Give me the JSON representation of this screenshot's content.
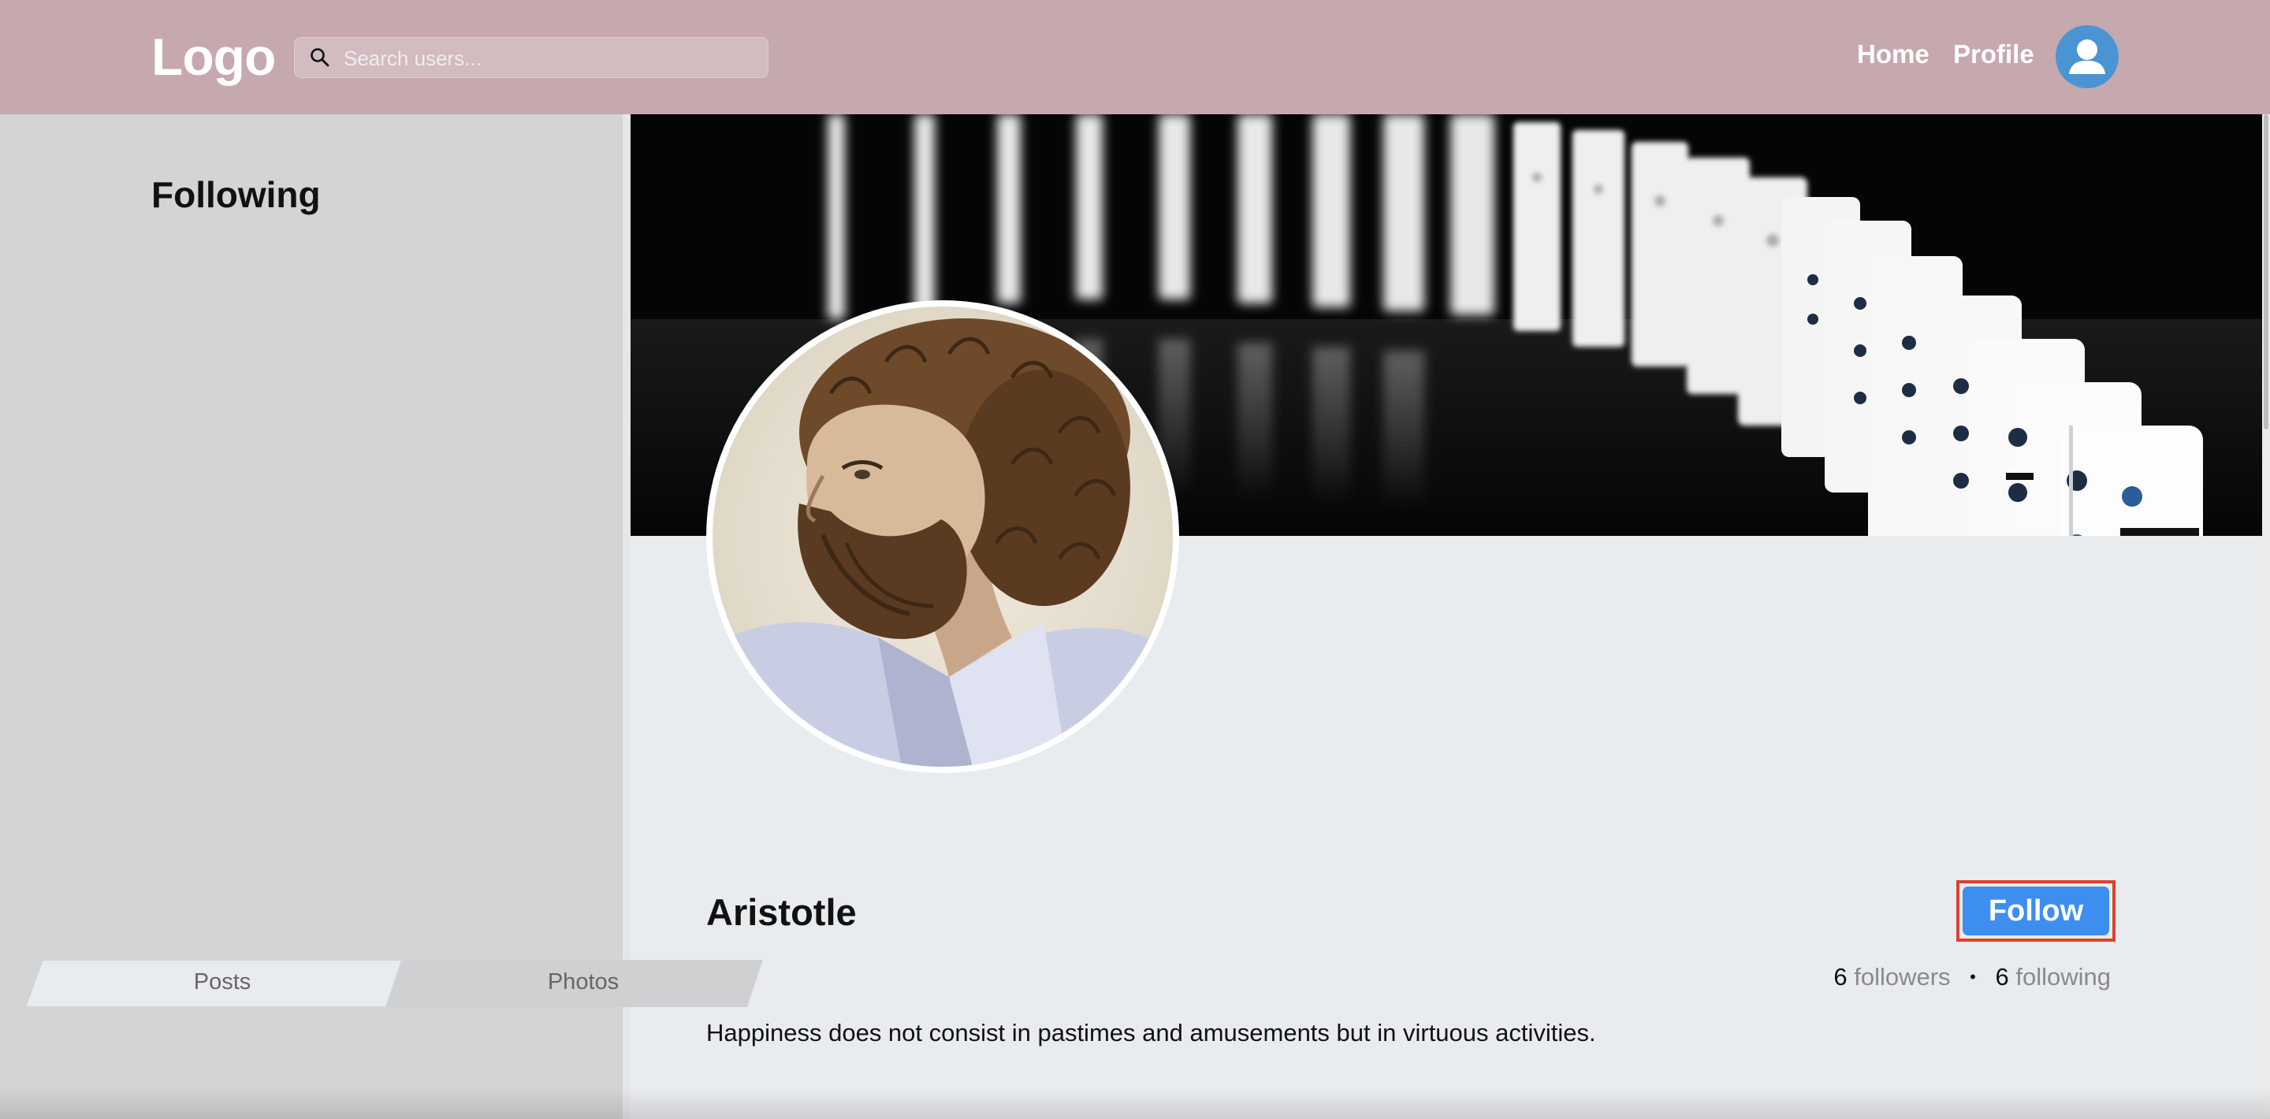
{
  "header": {
    "logo": "Logo",
    "search_placeholder": "Search users...",
    "search_value": "",
    "nav": {
      "home": "Home",
      "profile": "Profile"
    },
    "avatar_icon": "user-avatar-icon",
    "background_color": "#c6a9ae"
  },
  "sidebar": {
    "title": "Following",
    "items": []
  },
  "profile": {
    "cover_image": "dominoes-cover-image",
    "photo": "aristotle-portrait",
    "name": "Aristotle",
    "follow_label": "Follow",
    "followers_count": "6",
    "followers_label": "followers",
    "stats_separator": "•",
    "following_count": "6",
    "following_label": "following",
    "bio": "Happiness does not consist in pastimes and amusements but in virtuous activities."
  },
  "tabs": [
    {
      "label": "Posts"
    },
    {
      "label": "Photos"
    }
  ],
  "colors": {
    "follow_button": "#3e8ef0",
    "highlight_outline": "#e0402a",
    "main_background": "#e9ecef",
    "sidebar_background": "#d4d4d4"
  }
}
